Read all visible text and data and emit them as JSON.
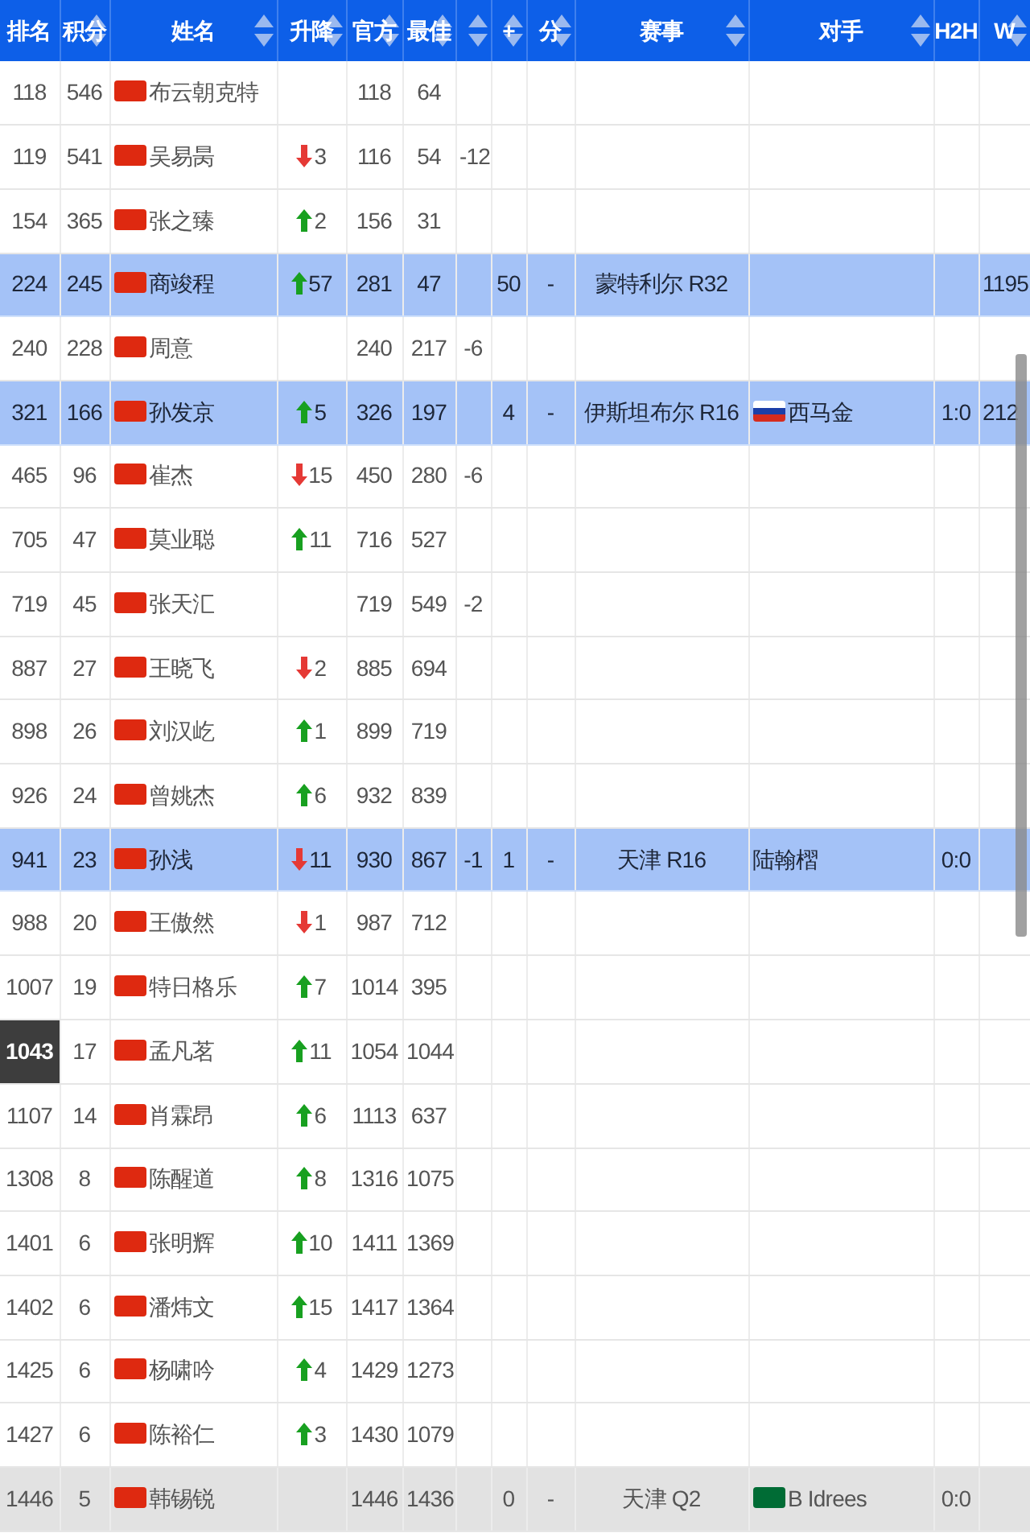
{
  "table": {
    "columns": [
      {
        "label": "排名",
        "sortable": false
      },
      {
        "label": "积分",
        "sortable": true
      },
      {
        "label": "姓名",
        "sortable": true
      },
      {
        "label": "升降",
        "sortable": true
      },
      {
        "label": "官方",
        "sortable": true
      },
      {
        "label": "最佳",
        "sortable": true
      },
      {
        "sortable": true
      },
      {
        "label": "+",
        "sortable": true
      },
      {
        "label": "分",
        "sortable": true
      },
      {
        "label": "赛事",
        "sortable": true
      },
      {
        "label": "对手",
        "sortable": true
      },
      {
        "label": "H2H",
        "sortable": false
      },
      {
        "label": "W",
        "sortable": true
      }
    ],
    "rows": [
      {
        "kind": "plain",
        "rank": "118",
        "rank_marked": false,
        "points": "546",
        "name": "布云朝克特",
        "official": "118",
        "best": "64"
      },
      {
        "kind": "plain",
        "rank": "119",
        "rank_marked": false,
        "points": "541",
        "name": "吴易昺",
        "change": {
          "kind": "down",
          "value": "3"
        },
        "official": "116",
        "best": "54",
        "column_7": "-12"
      },
      {
        "kind": "plain",
        "rank": "154",
        "rank_marked": false,
        "points": "365",
        "name": "张之臻",
        "change": {
          "kind": "up",
          "value": "2"
        },
        "official": "156",
        "best": "31"
      },
      {
        "kind": "highlight",
        "rank": "224",
        "rank_marked": false,
        "points": "245",
        "name": "商竣程",
        "change": {
          "kind": "up",
          "value": "57"
        },
        "official": "281",
        "best": "47",
        "column_8": "50",
        "column_9": "-",
        "event": "蒙特利尔 R32",
        "w": "1195"
      },
      {
        "kind": "plain",
        "rank": "240",
        "rank_marked": false,
        "points": "228",
        "name": "周意",
        "official": "240",
        "best": "217",
        "column_7": "-6"
      },
      {
        "kind": "highlight",
        "rank": "321",
        "rank_marked": false,
        "points": "166",
        "name": "孙发京",
        "change": {
          "kind": "up",
          "value": "5"
        },
        "official": "326",
        "best": "197",
        "column_8": "4",
        "column_9": "-",
        "event": "伊斯坦布尔 R16",
        "opponent": {
          "kind": "ru",
          "name": "西马金"
        },
        "h2h": "1:0",
        "w": "212"
      },
      {
        "kind": "plain",
        "rank": "465",
        "rank_marked": false,
        "points": "96",
        "name": "崔杰",
        "change": {
          "kind": "down",
          "value": "15"
        },
        "official": "450",
        "best": "280",
        "column_7": "-6"
      },
      {
        "kind": "plain",
        "rank": "705",
        "rank_marked": false,
        "points": "47",
        "name": "莫业聪",
        "change": {
          "kind": "up",
          "value": "11"
        },
        "official": "716",
        "best": "527"
      },
      {
        "kind": "plain",
        "rank": "719",
        "rank_marked": false,
        "points": "45",
        "name": "张天汇",
        "official": "719",
        "best": "549",
        "column_7": "-2"
      },
      {
        "kind": "plain",
        "rank": "887",
        "rank_marked": false,
        "points": "27",
        "name": "王晓飞",
        "change": {
          "kind": "down",
          "value": "2"
        },
        "official": "885",
        "best": "694"
      },
      {
        "kind": "plain",
        "rank": "898",
        "rank_marked": false,
        "points": "26",
        "name": "刘汉屹",
        "change": {
          "kind": "up",
          "value": "1"
        },
        "official": "899",
        "best": "719"
      },
      {
        "kind": "plain",
        "rank": "926",
        "rank_marked": false,
        "points": "24",
        "name": "曾姚杰",
        "change": {
          "kind": "up",
          "value": "6"
        },
        "official": "932",
        "best": "839"
      },
      {
        "kind": "highlight",
        "rank": "941",
        "rank_marked": false,
        "points": "23",
        "name": "孙浅",
        "change": {
          "kind": "down",
          "value": "11"
        },
        "official": "930",
        "best": "867",
        "column_7": "-1",
        "column_8": "1",
        "column_9": "-",
        "event": "天津 R16",
        "opponent": {
          "name": "陆翰槢"
        },
        "h2h": "0:0"
      },
      {
        "kind": "plain",
        "rank": "988",
        "rank_marked": false,
        "points": "20",
        "name": "王傲然",
        "change": {
          "kind": "down",
          "value": "1"
        },
        "official": "987",
        "best": "712"
      },
      {
        "kind": "plain",
        "rank": "1007",
        "rank_marked": false,
        "points": "19",
        "name": "特日格乐",
        "change": {
          "kind": "up",
          "value": "7"
        },
        "official": "1014",
        "best": "395"
      },
      {
        "kind": "plain",
        "rank": "1043",
        "rank_marked": true,
        "points": "17",
        "name": "孟凡茗",
        "change": {
          "kind": "up",
          "value": "11"
        },
        "official": "1054",
        "best": "1044"
      },
      {
        "kind": "plain",
        "rank": "1107",
        "rank_marked": false,
        "points": "14",
        "name": "肖霖昂",
        "change": {
          "kind": "up",
          "value": "6"
        },
        "official": "1113",
        "best": "637"
      },
      {
        "kind": "plain",
        "rank": "1308",
        "rank_marked": false,
        "points": "8",
        "name": "陈醒道",
        "change": {
          "kind": "up",
          "value": "8"
        },
        "official": "1316",
        "best": "1075"
      },
      {
        "kind": "plain",
        "rank": "1401",
        "rank_marked": false,
        "points": "6",
        "name": "张明辉",
        "change": {
          "kind": "up",
          "value": "10"
        },
        "official": "1411",
        "best": "1369"
      },
      {
        "kind": "plain",
        "rank": "1402",
        "rank_marked": false,
        "points": "6",
        "name": "潘炜文",
        "change": {
          "kind": "up",
          "value": "15"
        },
        "official": "1417",
        "best": "1364"
      },
      {
        "kind": "plain",
        "rank": "1425",
        "rank_marked": false,
        "points": "6",
        "name": "杨啸吟",
        "change": {
          "kind": "up",
          "value": "4"
        },
        "official": "1429",
        "best": "1273"
      },
      {
        "kind": "plain",
        "rank": "1427",
        "rank_marked": false,
        "points": "6",
        "name": "陈裕仁",
        "change": {
          "kind": "up",
          "value": "3"
        },
        "official": "1430",
        "best": "1079"
      },
      {
        "kind": "muted",
        "rank": "1446",
        "rank_marked": false,
        "points": "5",
        "name": "韩锡锐",
        "official": "1446",
        "best": "1436",
        "column_8": "0",
        "column_9": "-",
        "event": "天津 Q2",
        "opponent": {
          "kind": "sa",
          "name": "B Idrees"
        },
        "h2h": "0:0"
      }
    ]
  }
}
